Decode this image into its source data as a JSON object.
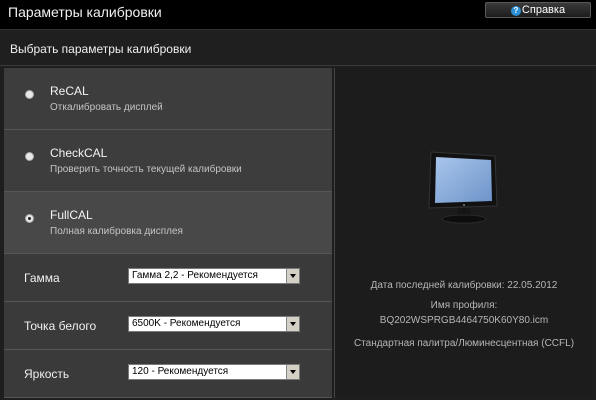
{
  "window": {
    "title": "Параметры калибровки"
  },
  "help": {
    "label": "Справка",
    "icon": "question-icon"
  },
  "panel": {
    "title": "Выбрать параметры калибровки"
  },
  "options": [
    {
      "name": "ReCAL",
      "desc": "Откалибровать дисплей",
      "selected": false
    },
    {
      "name": "CheckCAL",
      "desc": "Проверить точность текущей калибровки",
      "selected": false
    },
    {
      "name": "FullCAL",
      "desc": "Полная калибровка дисплея",
      "selected": true
    }
  ],
  "settings": [
    {
      "label": "Гамма",
      "value": "Гамма 2,2 - Рекомендуется"
    },
    {
      "label": "Точка белого",
      "value": "6500K - Рекомендуется"
    },
    {
      "label": "Яркость",
      "value": "120 - Рекомендуется"
    }
  ],
  "info": {
    "last_calibration": "Дата последней калибровки: 22.05.2012",
    "profile_label": "Имя профиля:",
    "profile_name": "BQ202WSPRGB4464750K60Y80.icm",
    "palette": "Стандартная палитра/Люминесцентная (CCFL)"
  },
  "colors": {
    "screen": "#7fa6d9",
    "background": "#1e1e1e"
  }
}
